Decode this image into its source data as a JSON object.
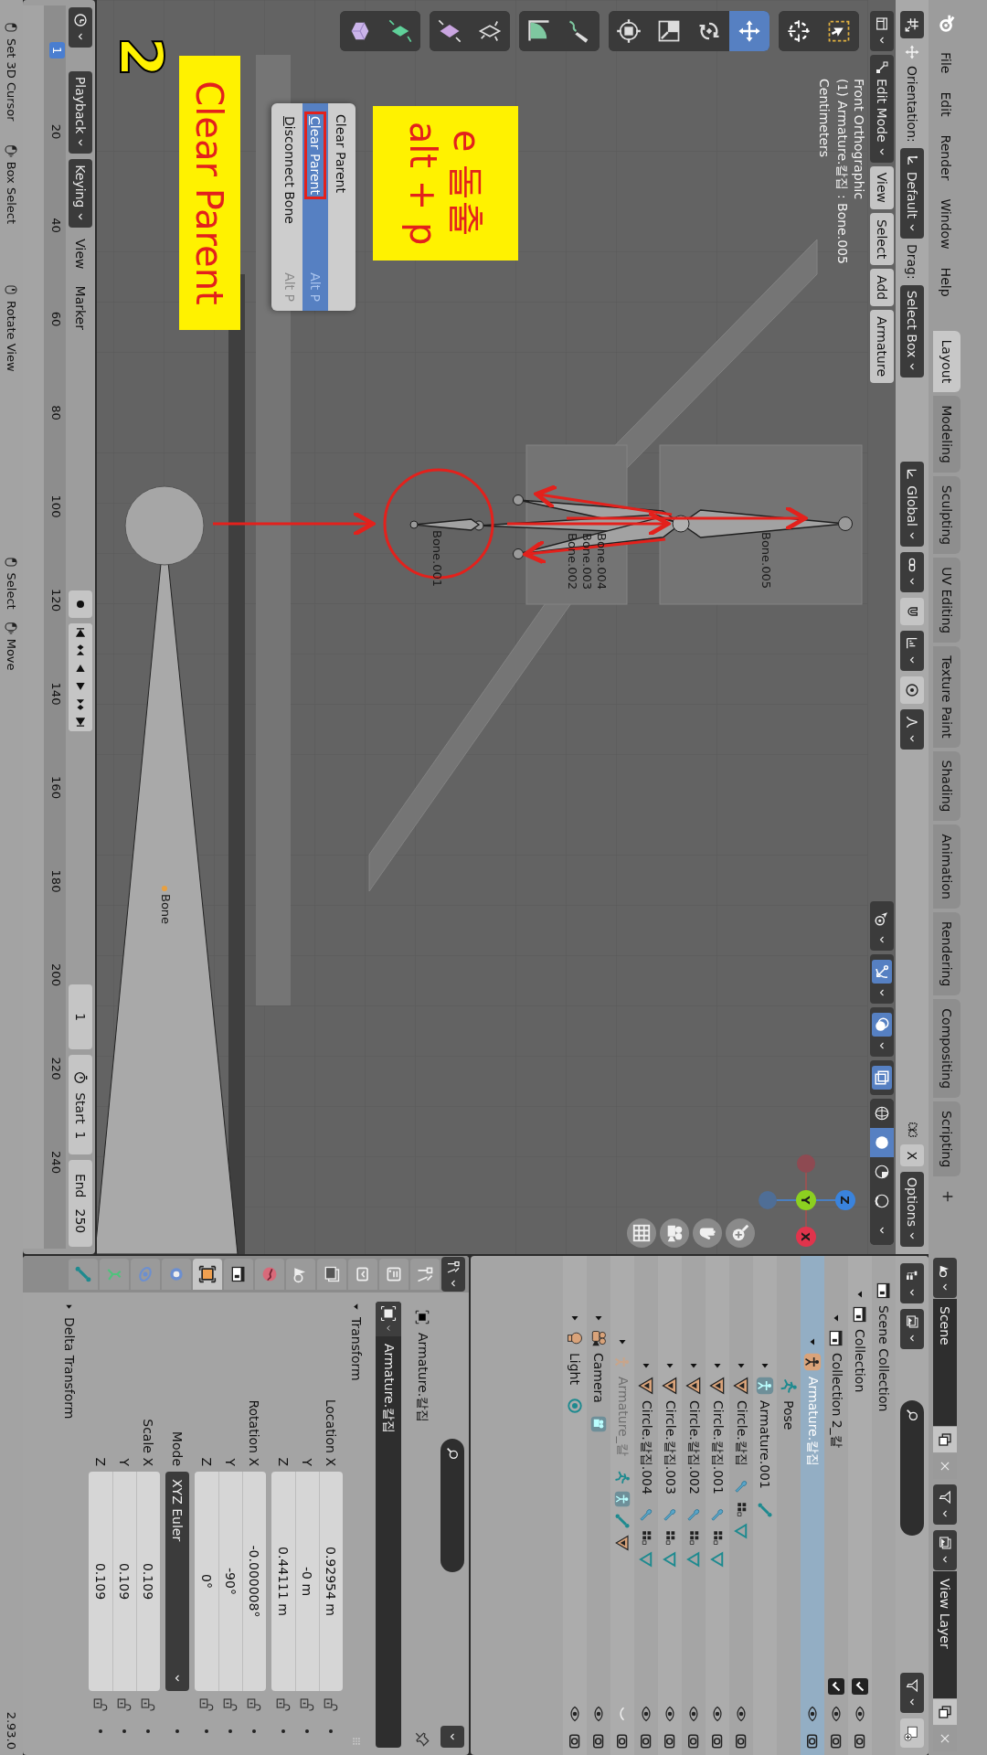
{
  "top_bar": {
    "menus": [
      "File",
      "Edit",
      "Render",
      "Window",
      "Help"
    ],
    "workspaces": [
      {
        "label": "Layout",
        "selected": true
      },
      {
        "label": "Modeling",
        "selected": false
      },
      {
        "label": "Sculpting",
        "selected": false
      },
      {
        "label": "UV Editing",
        "selected": false
      },
      {
        "label": "Texture Paint",
        "selected": false
      },
      {
        "label": "Shading",
        "selected": false
      },
      {
        "label": "Animation",
        "selected": false
      },
      {
        "label": "Rendering",
        "selected": false
      },
      {
        "label": "Compositing",
        "selected": false
      },
      {
        "label": "Scripting",
        "selected": false
      }
    ],
    "scene": "Scene",
    "view_layer": "View Layer"
  },
  "tool_settings": {
    "orientation_label": "Orientation:",
    "orientation": "Default",
    "drag_label": "Drag:",
    "drag": "Select Box",
    "transform_orientation": "Global",
    "mirror": {
      "label": "X",
      "selected": false
    },
    "options": "Options"
  },
  "viewport": {
    "mode": "Edit Mode",
    "menus": [
      "View",
      "Select",
      "Add",
      "Armature"
    ],
    "toggles": [
      {
        "kind": "selectability",
        "selected": false
      },
      {
        "kind": "gizmo",
        "selected": true
      },
      {
        "kind": "overlay",
        "selected": true
      },
      {
        "kind": "xray",
        "selected": true
      }
    ],
    "shading": [
      {
        "kind": "wireframe",
        "selected": false
      },
      {
        "kind": "solid",
        "selected": true
      },
      {
        "kind": "material",
        "selected": false
      },
      {
        "kind": "rendered",
        "selected": false
      }
    ],
    "info": [
      "Front Orthographic",
      "(1) Armature.칼집 : Bone.005",
      "Centimeters"
    ],
    "tool_groups": [
      [
        {
          "kind": "select_box",
          "selected": false
        },
        {
          "kind": "cursor",
          "selected": false
        }
      ],
      [
        {
          "kind": "move",
          "selected": true
        },
        {
          "kind": "rotate",
          "selected": false
        },
        {
          "kind": "scale",
          "selected": false
        },
        {
          "kind": "transform",
          "selected": false
        }
      ],
      [
        {
          "kind": "annotate",
          "selected": false
        },
        {
          "kind": "measure",
          "selected": false
        }
      ],
      [
        {
          "kind": "roll",
          "selected": false
        },
        {
          "kind": "envelope",
          "selected": false
        }
      ],
      [
        {
          "kind": "extrude",
          "selected": false
        },
        {
          "kind": "extrude_cursor",
          "selected": false
        }
      ]
    ],
    "bones": [
      "Bone.005",
      "Bone.004",
      "Bone.003",
      "Bone.002",
      "Bone.001",
      "Bone"
    ],
    "gizmo_axes": [
      "X",
      "Y",
      "Z"
    ],
    "context_menu": {
      "title": "Clear Parent",
      "items": [
        {
          "label": "Clear Parent",
          "shortcut": "Alt P",
          "selected": true,
          "framed": true
        },
        {
          "label": "Disconnect Bone",
          "shortcut": "Alt P",
          "selected": false,
          "framed": false
        }
      ]
    },
    "notes": [
      {
        "kind": "note",
        "lines": [
          "e 돌출",
          "alt + p"
        ]
      },
      {
        "kind": "note",
        "lines": [
          "Clear Parent"
        ]
      },
      {
        "kind": "step",
        "lines": [
          "2"
        ]
      }
    ]
  },
  "outliner": {
    "tree": [
      {
        "label": "Scene Collection",
        "kind": "collection",
        "selected": false,
        "children": [
          {
            "label": "Collection",
            "kind": "collection",
            "selected": false,
            "expanded": true,
            "checked": true,
            "visible": true,
            "renderable": true,
            "children": [
              {
                "label": "Collection 2_칼",
                "kind": "collection",
                "selected": false,
                "expanded": true,
                "checked": true,
                "visible": true,
                "renderable": true,
                "children": [
                  {
                    "label": "Armature.칼집",
                    "kind": "armature",
                    "selected": true,
                    "expanded": true,
                    "visible": true,
                    "renderable": true,
                    "children": [
                      {
                        "label": "Pose",
                        "kind": "pose",
                        "selected": false
                      },
                      {
                        "label": "Armature.001",
                        "kind": "armature_data",
                        "selected": false,
                        "expanded": false
                      },
                      {
                        "label": "Circle.칼집",
                        "kind": "mesh",
                        "selected": false,
                        "expanded": false,
                        "visible": true,
                        "renderable": true
                      },
                      {
                        "label": "Circle.칼집.001",
                        "kind": "mesh",
                        "selected": false,
                        "expanded": false,
                        "visible": true,
                        "renderable": true
                      },
                      {
                        "label": "Circle.칼집.002",
                        "kind": "mesh",
                        "selected": false,
                        "expanded": false,
                        "visible": true,
                        "renderable": true
                      },
                      {
                        "label": "Circle.칼집.003",
                        "kind": "mesh",
                        "selected": false,
                        "expanded": false,
                        "visible": true,
                        "renderable": true
                      },
                      {
                        "label": "Circle.칼집.004",
                        "kind": "mesh",
                        "selected": false,
                        "expanded": false,
                        "visible": true,
                        "renderable": true
                      }
                    ]
                  },
                  {
                    "label": "Armature_칼",
                    "kind": "armature_hidden",
                    "selected": false,
                    "expanded": false,
                    "visible": false,
                    "renderable": true
                  }
                ]
              },
              {
                "label": "Camera",
                "kind": "camera",
                "selected": false,
                "expanded": false,
                "visible": true,
                "renderable": true
              },
              {
                "label": "Light",
                "kind": "light",
                "selected": false,
                "expanded": false,
                "visible": true,
                "renderable": true
              }
            ]
          }
        ]
      }
    ]
  },
  "properties": {
    "tabs": [
      {
        "kind": "tool",
        "selected": false
      },
      {
        "kind": "render",
        "selected": false
      },
      {
        "kind": "output",
        "selected": false
      },
      {
        "kind": "view_layer",
        "selected": false
      },
      {
        "kind": "scene",
        "selected": false
      },
      {
        "kind": "world",
        "selected": false
      },
      {
        "kind": "collection",
        "selected": false
      },
      {
        "kind": "object",
        "selected": true
      },
      {
        "kind": "modifiers",
        "selected": false
      },
      {
        "kind": "physics",
        "selected": false
      },
      {
        "kind": "data",
        "selected": false
      },
      {
        "kind": "bone",
        "selected": false
      }
    ],
    "object_name": "Armature.칼집",
    "name_field": "Armature.칼집",
    "transform": {
      "title": "Transform",
      "expanded": true,
      "rows": [
        {
          "kind": "vector",
          "labels": [
            "Location X",
            "Y",
            "Z"
          ],
          "values": [
            "0.92954 m",
            "-0 m",
            "0.44111 m"
          ],
          "locked": false
        },
        {
          "kind": "vector",
          "labels": [
            "Rotation X",
            "Y",
            "Z"
          ],
          "values": [
            "-0.000008°",
            "-90°",
            "0°"
          ],
          "locked": false
        },
        {
          "kind": "dropdown",
          "labels": [
            "Mode"
          ],
          "values": [
            "XYZ Euler"
          ]
        },
        {
          "kind": "vector",
          "labels": [
            "Scale X",
            "Y",
            "Z"
          ],
          "values": [
            "0.109",
            "0.109",
            "0.109"
          ],
          "locked": false
        }
      ]
    },
    "delta_transform": {
      "title": "Delta Transform",
      "expanded": false
    }
  },
  "timeline": {
    "menus": [
      "Playback",
      "Keying",
      "View",
      "Marker"
    ],
    "auto_key": false,
    "current_frame": "1",
    "start_label": "Start",
    "start": "1",
    "end_label": "End",
    "end": "250",
    "playhead": "1",
    "ruler": [
      "20",
      "40",
      "60",
      "80",
      "100",
      "120",
      "140",
      "160",
      "180",
      "200",
      "220",
      "240"
    ]
  },
  "status_bar": {
    "hints": [
      {
        "kind": "left",
        "label": "Set 3D Cursor"
      },
      {
        "kind": "drag",
        "label": "Box Select"
      },
      {
        "kind": "middle",
        "label": "Rotate View"
      },
      {
        "kind": "left",
        "label": "Select"
      },
      {
        "kind": "drag",
        "label": "Move"
      }
    ],
    "version": "2.93.0"
  }
}
